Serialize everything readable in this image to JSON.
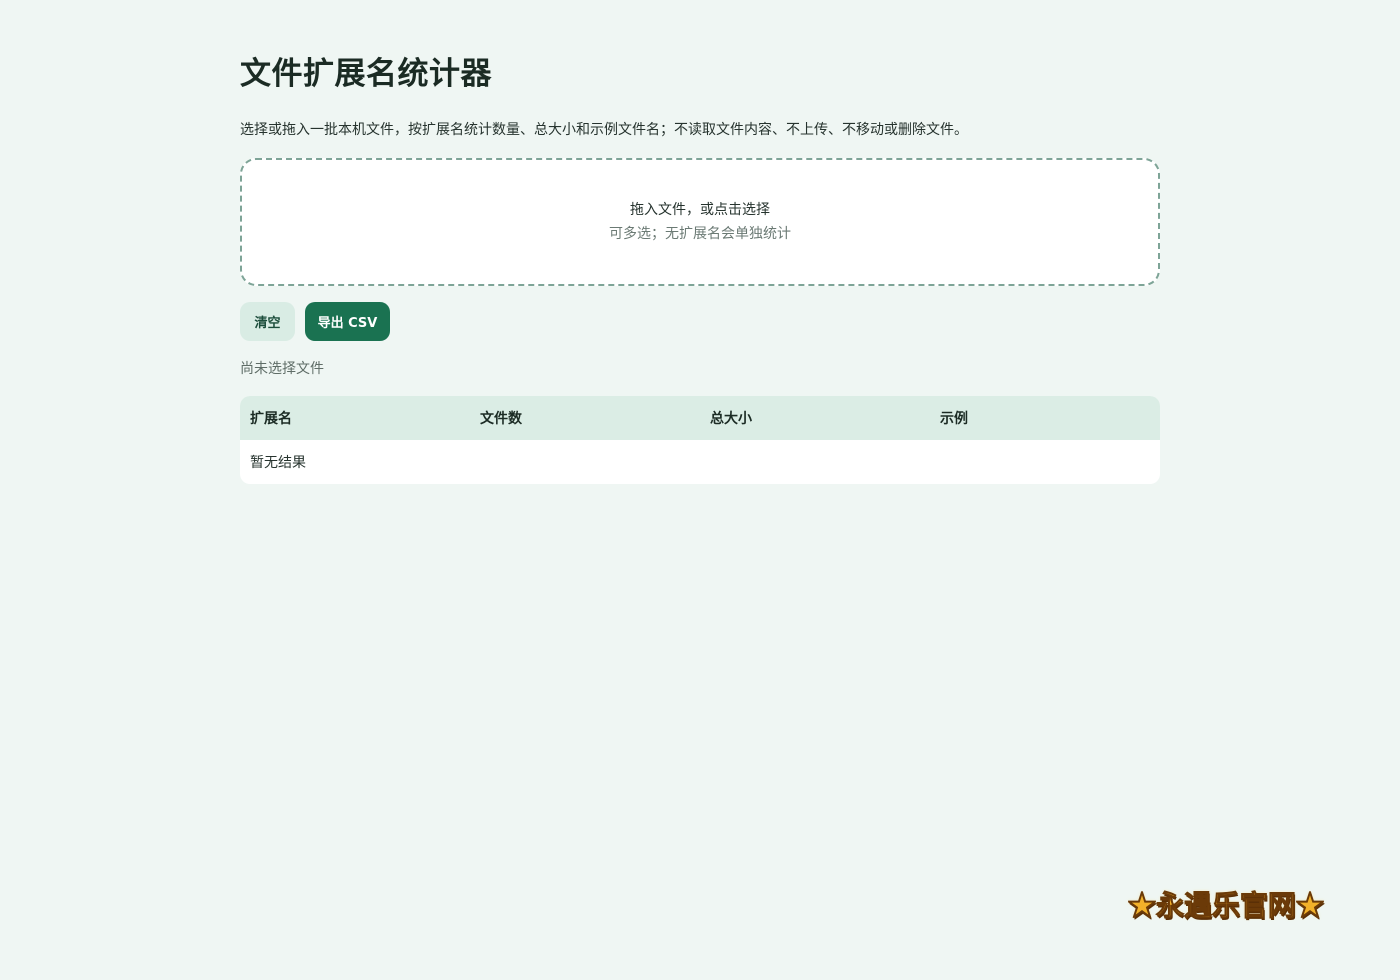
{
  "page": {
    "title": "文件扩展名统计器",
    "intro": "选择或拖入一批本机文件，按扩展名统计数量、总大小和示例文件名；不读取文件内容、不上传、不移动或删除文件。"
  },
  "dropzone": {
    "main_text": "拖入文件，或点击选择",
    "sub_text": "可多选；无扩展名会单独统计"
  },
  "actions": {
    "clear_label": "清空",
    "export_label": "导出 CSV"
  },
  "status": {
    "text": "尚未选择文件"
  },
  "table": {
    "headers": [
      "扩展名",
      "文件数",
      "总大小",
      "示例"
    ],
    "empty_text": "暂无结果"
  },
  "watermark": {
    "text": "★永遇乐官网★"
  },
  "colors": {
    "background": "#eff6f3",
    "accent": "#1a7251",
    "secondary_button": "#d9ece4",
    "table_header": "#dbede5",
    "dropzone_border": "#7ea497"
  }
}
